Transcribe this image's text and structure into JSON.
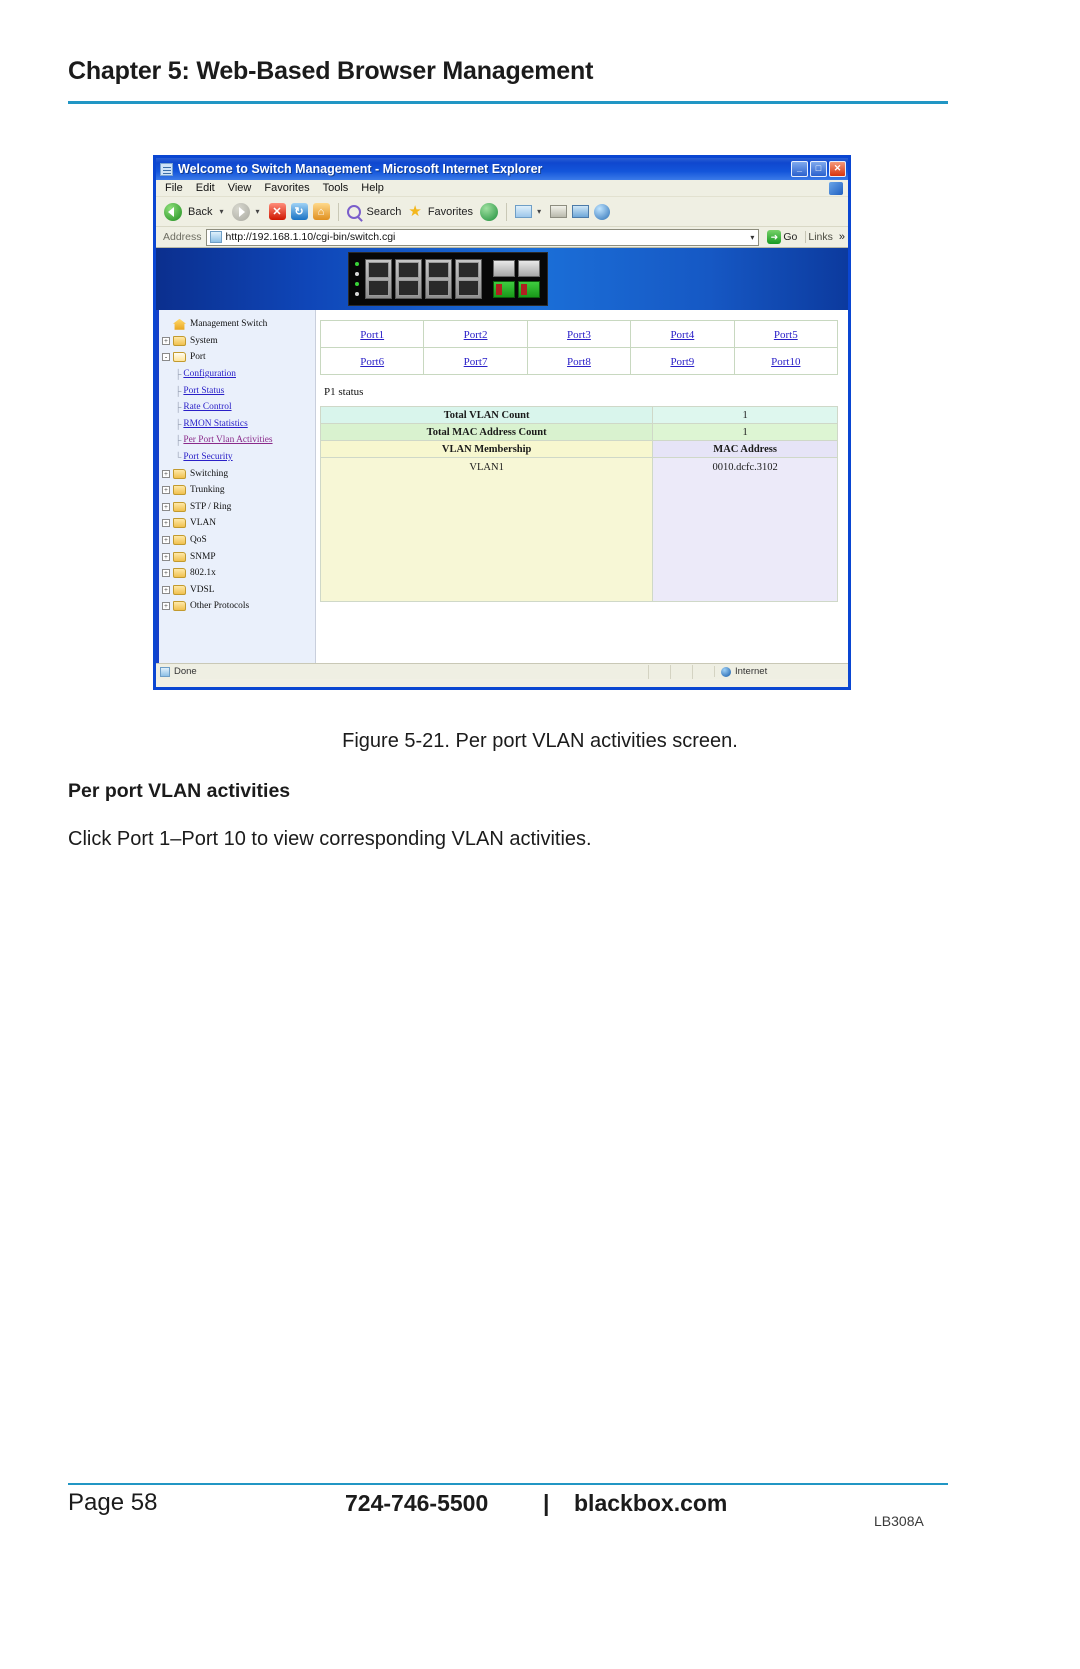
{
  "page": {
    "chapter_title": "Chapter 5: Web-Based Browser Management",
    "figure_caption": "Figure 5-21. Per port VLAN activities screen.",
    "section_heading": "Per port VLAN activities",
    "body_text": "Click Port 1–Port 10 to view corresponding VLAN activities.",
    "accent_color": "#2196c4"
  },
  "footer": {
    "page_number": "Page 58",
    "phone": "724-746-5500",
    "separator": "|",
    "website": "blackbox.com",
    "part_number": "LB308A"
  },
  "browser": {
    "title": "Welcome to Switch Management - Microsoft Internet Explorer",
    "window_buttons": {
      "minimize": "_",
      "maximize": "□",
      "close": "✕"
    },
    "menu": [
      "File",
      "Edit",
      "View",
      "Favorites",
      "Tools",
      "Help"
    ],
    "toolbar": {
      "back_label": "Back",
      "back_caret": "▾",
      "forward_caret": "▾",
      "stop_glyph": "✕",
      "refresh_glyph": "↻",
      "home_glyph": "⌂",
      "search_label": "Search",
      "favorites_label": "Favorites",
      "icons": [
        "back-icon",
        "forward-icon",
        "stop-icon",
        "refresh-icon",
        "home-icon",
        "search-icon",
        "favorites-star-icon",
        "history-icon",
        "mail-icon",
        "print-icon",
        "edit-icon",
        "messenger-icon"
      ]
    },
    "address": {
      "label": "Address",
      "url": "http://192.168.1.10/cgi-bin/switch.cgi",
      "dropdown_caret": "▾",
      "go_label": "Go",
      "go_glyph": "➜",
      "links_label": "Links",
      "overflow_glyph": "»"
    },
    "status": {
      "text": "Done",
      "zone": "Internet"
    }
  },
  "sidebar": {
    "root": "Management Switch",
    "items": [
      {
        "label": "System",
        "type": "folder",
        "expander": "+"
      },
      {
        "label": "Port",
        "type": "folder-open",
        "expander": "-"
      },
      {
        "label": "Switching",
        "type": "folder",
        "expander": "+"
      },
      {
        "label": "Trunking",
        "type": "folder",
        "expander": "+"
      },
      {
        "label": "STP / Ring",
        "type": "folder",
        "expander": "+"
      },
      {
        "label": "VLAN",
        "type": "folder",
        "expander": "+"
      },
      {
        "label": "QoS",
        "type": "folder",
        "expander": "+"
      },
      {
        "label": "SNMP",
        "type": "folder",
        "expander": "+"
      },
      {
        "label": "802.1x",
        "type": "folder",
        "expander": "+"
      },
      {
        "label": "VDSL",
        "type": "folder",
        "expander": "+"
      },
      {
        "label": "Other Protocols",
        "type": "folder",
        "expander": "+"
      }
    ],
    "port_children": [
      {
        "label": "Configuration",
        "active": false
      },
      {
        "label": "Port Status",
        "active": false
      },
      {
        "label": "Rate Control",
        "active": false
      },
      {
        "label": "RMON Statistics",
        "active": false
      },
      {
        "label": "Per Port Vlan Activities",
        "active": true
      },
      {
        "label": "Port Security",
        "active": false
      }
    ]
  },
  "content": {
    "port_links": [
      [
        "Port1",
        "Port2",
        "Port3",
        "Port4",
        "Port5"
      ],
      [
        "Port6",
        "Port7",
        "Port8",
        "Port9",
        "Port10"
      ]
    ],
    "status_label": "P1 status",
    "table": {
      "rows": [
        {
          "label": "Total VLAN Count",
          "value": "1"
        },
        {
          "label": "Total MAC Address Count",
          "value": "1"
        }
      ],
      "headers": [
        "VLAN Membership",
        "MAC Address"
      ],
      "data": [
        {
          "vlan": "VLAN1",
          "mac": "0010.dcfc.3102"
        }
      ]
    }
  }
}
